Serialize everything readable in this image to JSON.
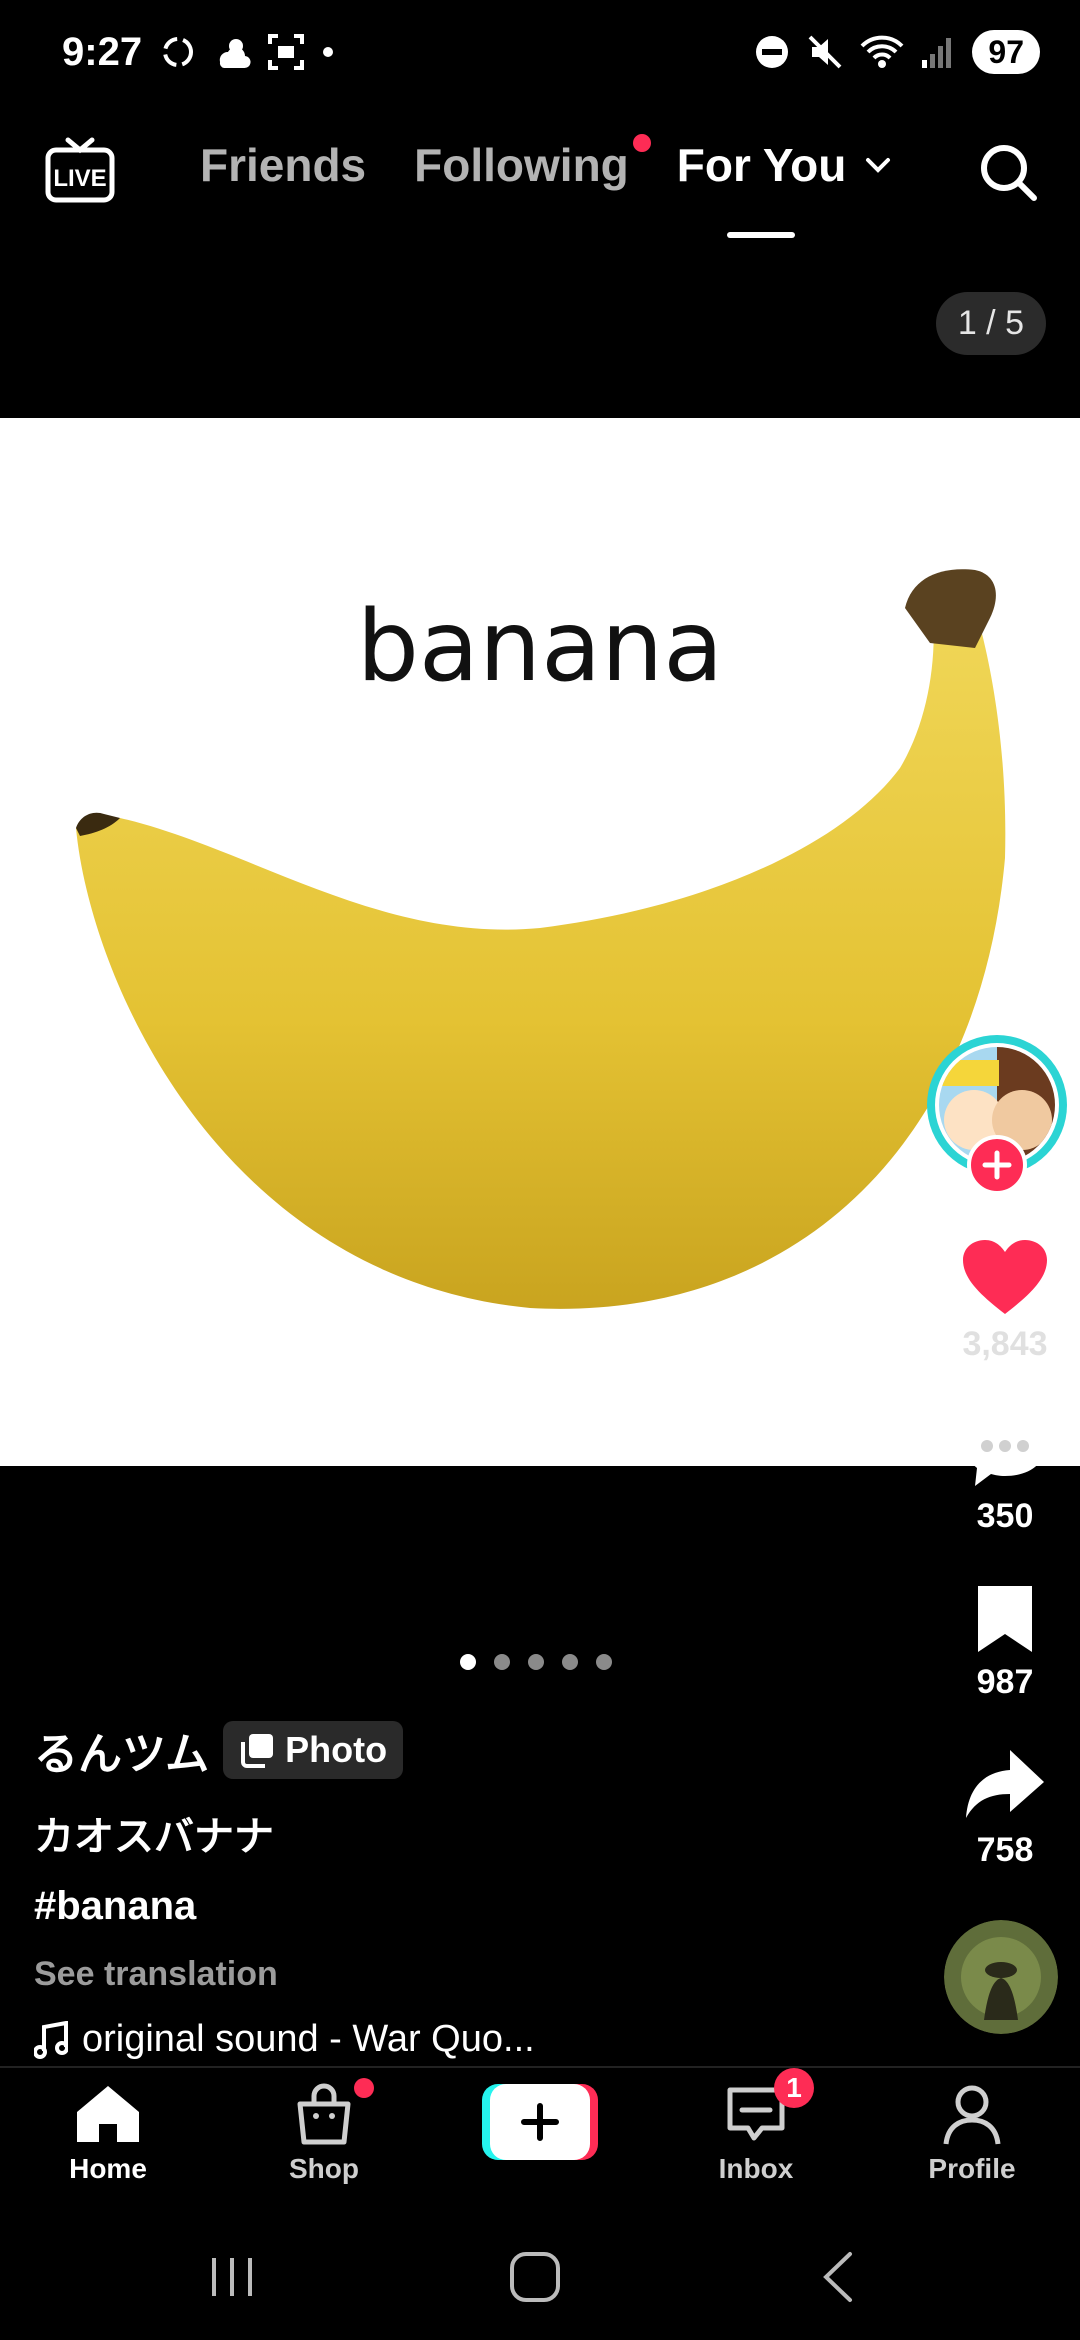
{
  "status_bar": {
    "time": "9:27",
    "battery": "97"
  },
  "top_nav": {
    "live_label": "LIVE",
    "tabs": [
      {
        "label": "Friends",
        "active": false,
        "dot": false
      },
      {
        "label": "Following",
        "active": false,
        "dot": true
      },
      {
        "label": "For You",
        "active": true,
        "dot": false
      }
    ]
  },
  "page_counter": "1 / 5",
  "photo_text": "banana",
  "carousel": {
    "count": 5,
    "current": 1
  },
  "actions": {
    "likes": "3,843",
    "comments": "350",
    "saves": "987",
    "shares": "758"
  },
  "caption": {
    "author": "るんツム",
    "badge": "Photo",
    "title": "カオスバナナ",
    "hashtag": "#banana",
    "see_translation": "See translation",
    "sound": "original sound - War Quo..."
  },
  "bottom_nav": {
    "items": [
      {
        "label": "Home",
        "icon": "home-icon"
      },
      {
        "label": "Shop",
        "icon": "shop-icon"
      },
      {
        "label": "",
        "icon": "plus-icon"
      },
      {
        "label": "Inbox",
        "icon": "inbox-icon",
        "badge": "1"
      },
      {
        "label": "Profile",
        "icon": "profile-icon"
      }
    ]
  },
  "colors": {
    "accent": "#fe2c55",
    "cyan": "#25f4ee",
    "banana": "#e8c63a"
  }
}
